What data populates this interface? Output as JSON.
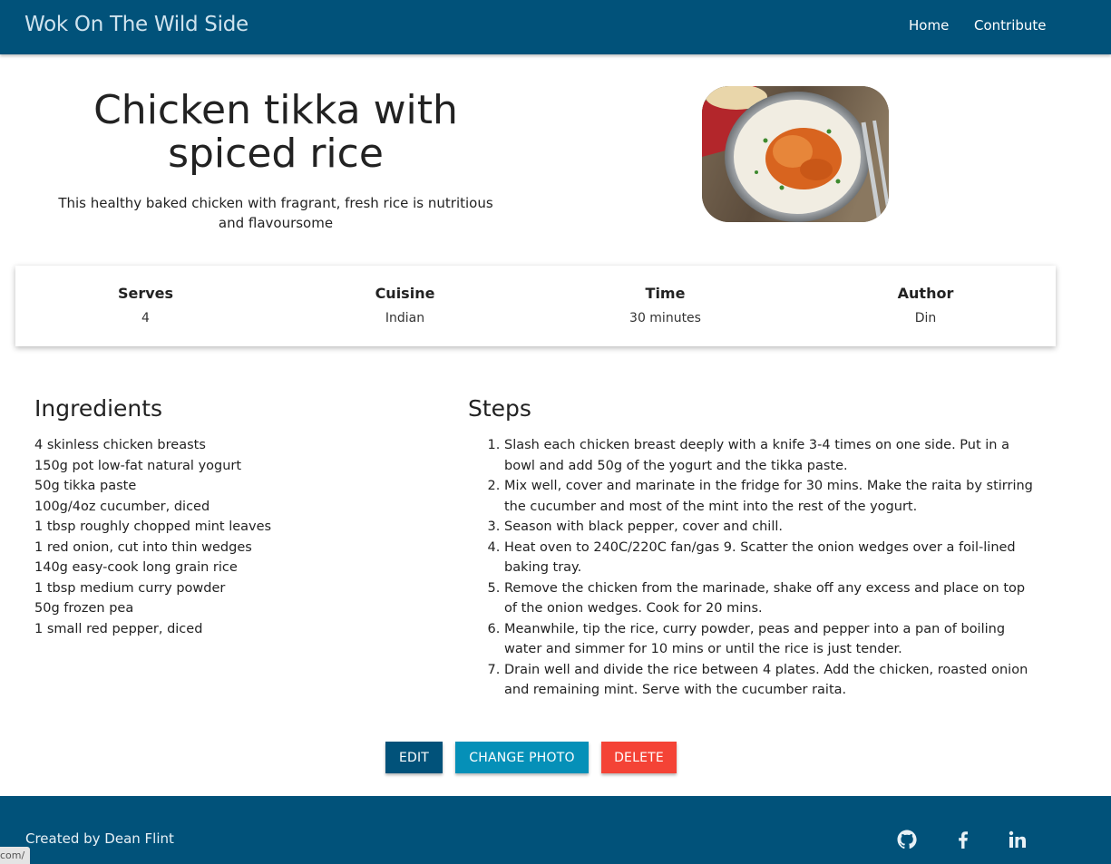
{
  "nav": {
    "brand": "Wok On The Wild Side",
    "links": [
      {
        "label": "Home"
      },
      {
        "label": "Contribute"
      }
    ]
  },
  "recipe": {
    "title": "Chicken tikka with spiced rice",
    "description": "This healthy baked chicken with fragrant, fresh rice is nutritious and flavoursome",
    "info": [
      {
        "label": "Serves",
        "value": "4"
      },
      {
        "label": "Cuisine",
        "value": "Indian"
      },
      {
        "label": "Time",
        "value": "30 minutes"
      },
      {
        "label": "Author",
        "value": "Din"
      }
    ],
    "ingredients_heading": "Ingredients",
    "ingredients": [
      "4 skinless chicken breasts",
      "150g pot low-fat natural yogurt",
      "50g tikka paste",
      "100g/4oz cucumber, diced",
      "1 tbsp roughly chopped mint leaves",
      "1 red onion, cut into thin wedges",
      "140g easy-cook long grain rice",
      "1 tbsp medium curry powder",
      "50g frozen pea",
      "1 small red pepper, diced"
    ],
    "steps_heading": "Steps",
    "steps": [
      "Slash each chicken breast deeply with a knife 3-4 times on one side. Put in a bowl and add 50g of the yogurt and the tikka paste.",
      "Mix well, cover and marinate in the fridge for 30 mins. Make the raita by stirring the cucumber and most of the mint into the rest of the yogurt.",
      "Season with black pepper, cover and chill.",
      "Heat oven to 240C/220C fan/gas 9. Scatter the onion wedges over a foil-lined baking tray.",
      "Remove the chicken from the marinade, shake off any excess and place on top of the onion wedges. Cook for 20 mins.",
      "Meanwhile, tip the rice, curry powder, peas and pepper into a pan of boiling water and simmer for 10 mins or until the rice is just tender.",
      "Drain well and divide the rice between 4 plates. Add the chicken, roasted onion and remaining mint. Serve with the cucumber raita."
    ]
  },
  "actions": {
    "edit": "EDIT",
    "change_photo": "CHANGE PHOTO",
    "delete": "DELETE"
  },
  "footer": {
    "credit": "Created by Dean Flint",
    "social_icons": [
      "github-icon",
      "facebook-icon",
      "linkedin-icon"
    ]
  },
  "status_bar": {
    "url": "com/"
  },
  "colors": {
    "primary": "#01527a",
    "secondary": "#0590b8",
    "danger": "#f44336"
  }
}
